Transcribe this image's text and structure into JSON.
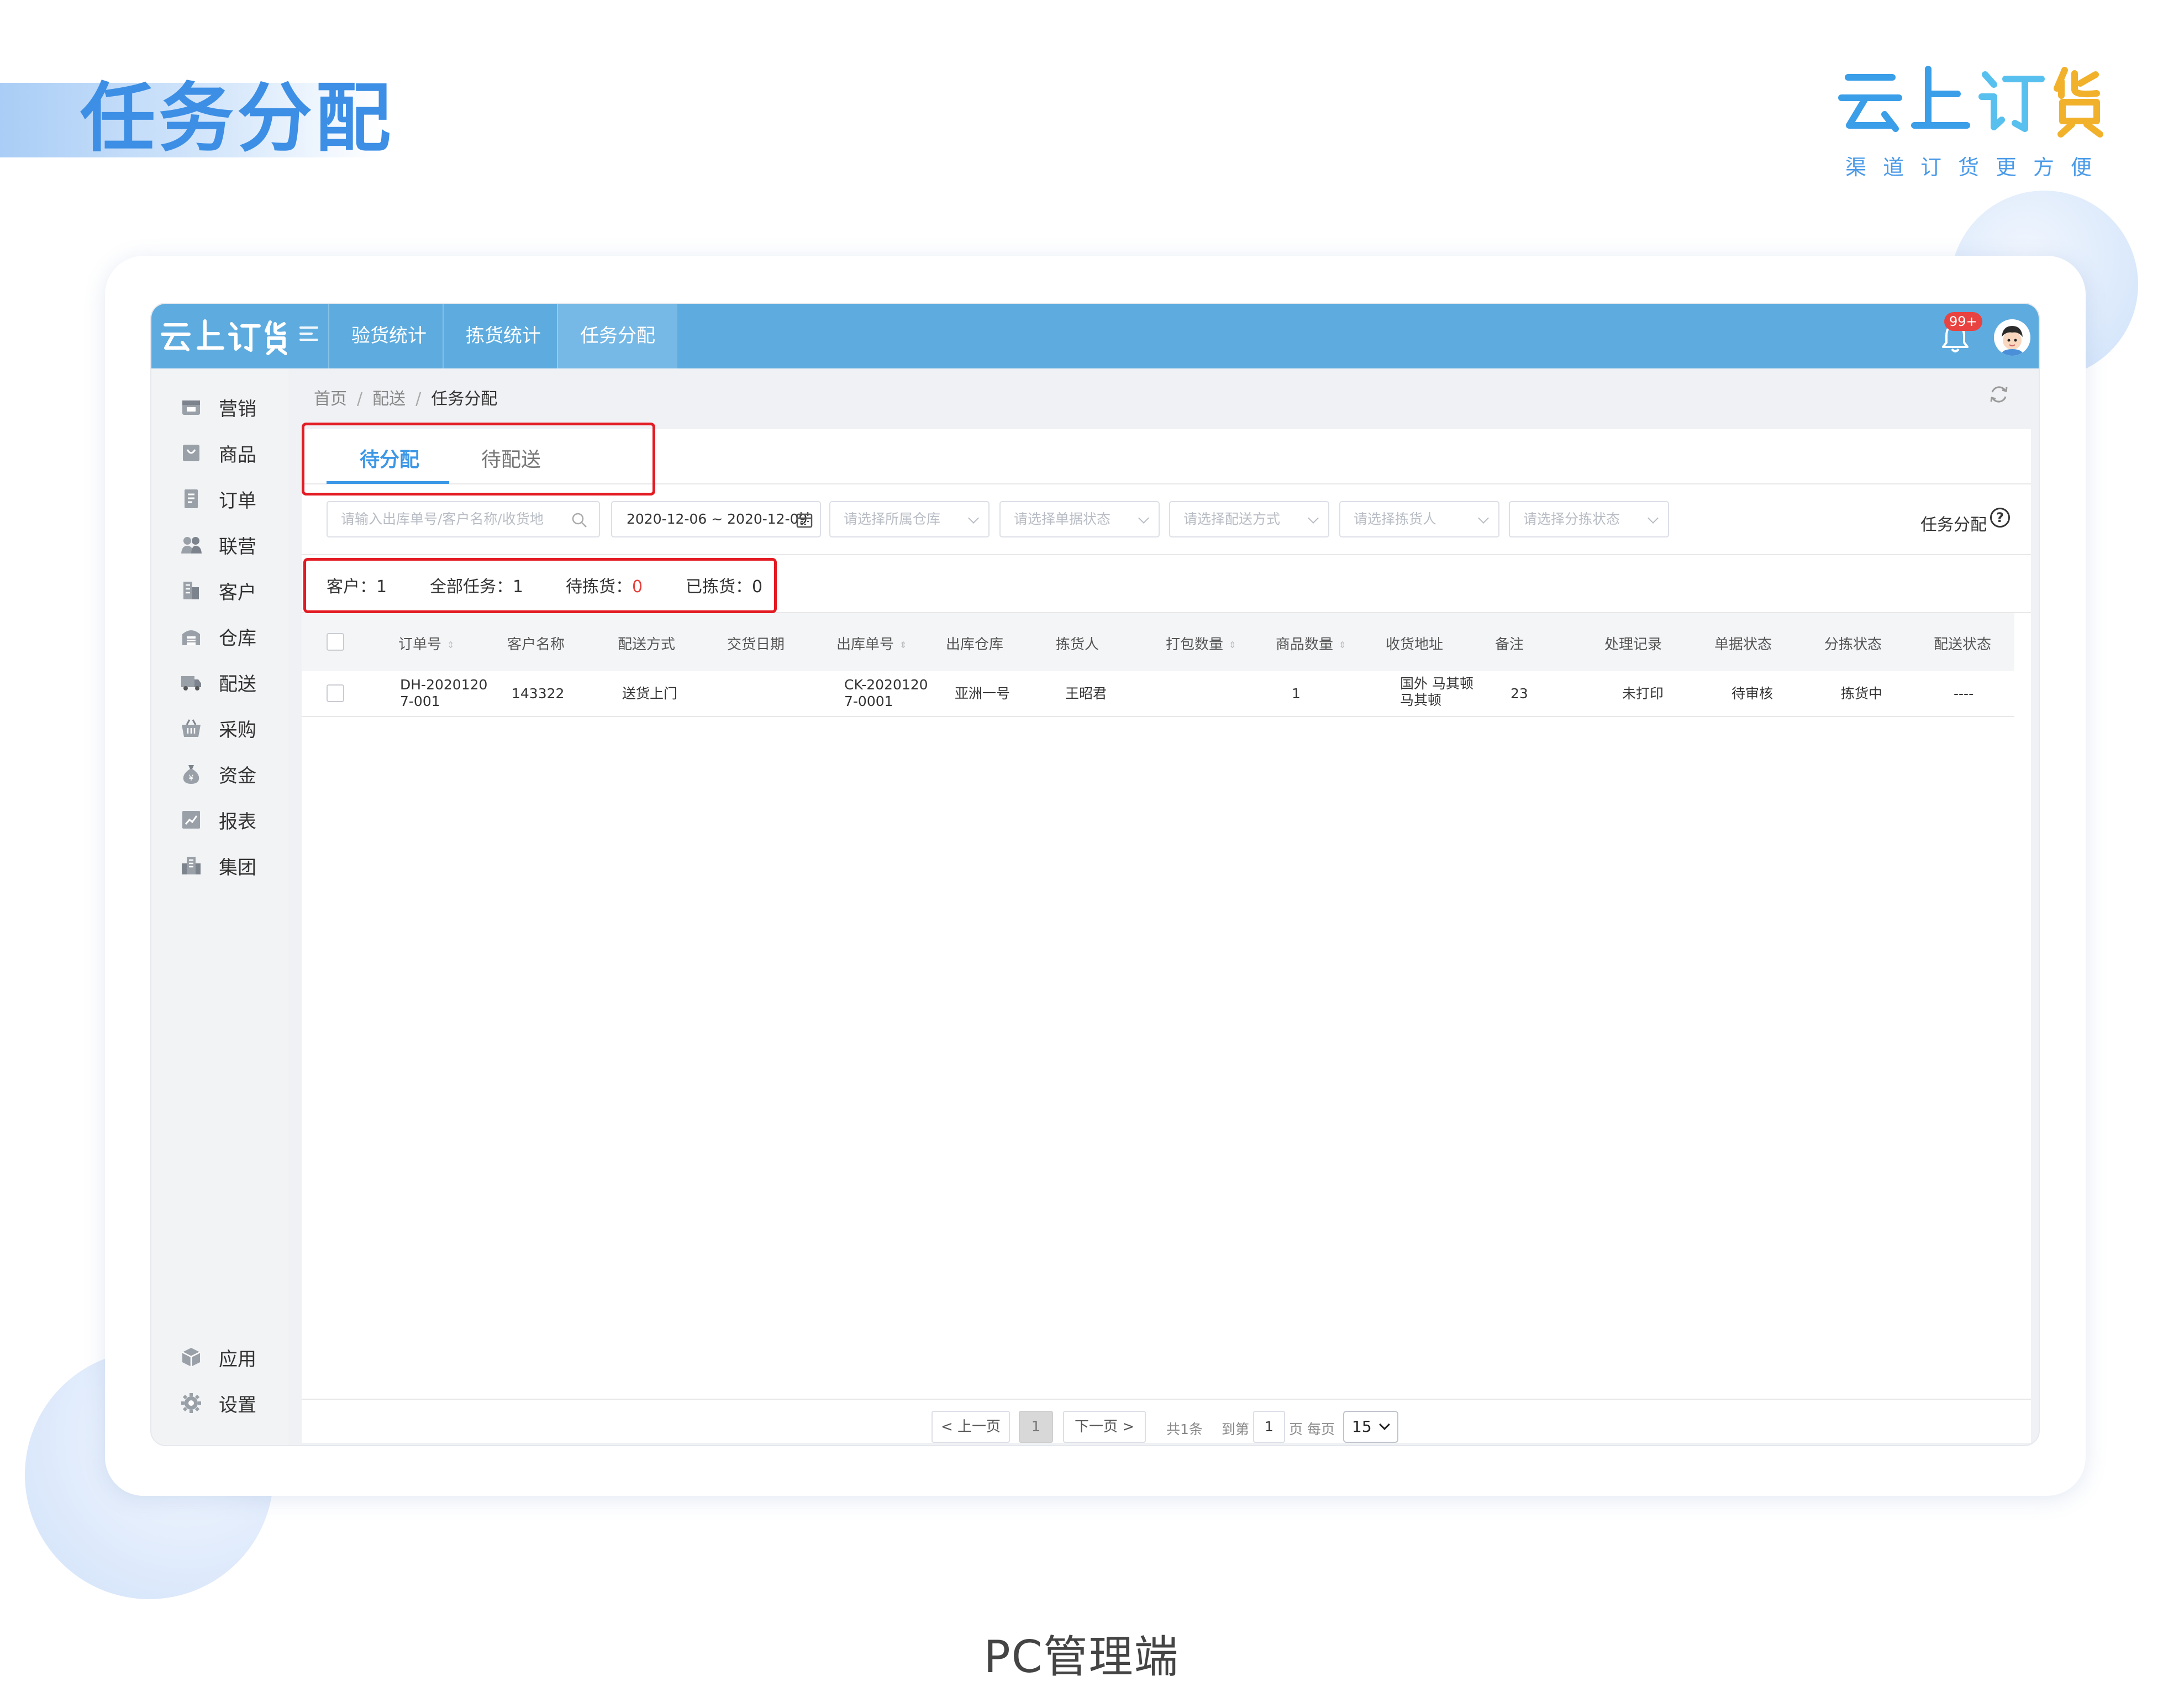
{
  "page": {
    "title": "任务分配",
    "brand_name": "云上订货",
    "brand_slogan": "渠道订货更方便",
    "caption": "PC管理端"
  },
  "colors": {
    "topbar": "#5eacdf",
    "accent": "#3c97e6",
    "highlight_box": "#e31b23",
    "danger": "#e8413c"
  },
  "topbar": {
    "logo_text": "云上订货",
    "tabs": [
      {
        "label": "验货统计",
        "active": false
      },
      {
        "label": "拣货统计",
        "active": false
      },
      {
        "label": "任务分配",
        "active": true
      }
    ],
    "notification_badge": "99+",
    "icons": [
      "menu-toggle-icon",
      "bell-icon",
      "avatar"
    ]
  },
  "sidebar": {
    "items": [
      {
        "label": "营销",
        "icon": "marketing-icon"
      },
      {
        "label": "商品",
        "icon": "product-icon"
      },
      {
        "label": "订单",
        "icon": "order-icon"
      },
      {
        "label": "联营",
        "icon": "partner-icon"
      },
      {
        "label": "客户",
        "icon": "customer-icon"
      },
      {
        "label": "仓库",
        "icon": "warehouse-icon"
      },
      {
        "label": "配送",
        "icon": "delivery-icon"
      },
      {
        "label": "采购",
        "icon": "purchase-icon"
      },
      {
        "label": "资金",
        "icon": "funds-icon"
      },
      {
        "label": "报表",
        "icon": "report-icon"
      },
      {
        "label": "集团",
        "icon": "group-icon"
      }
    ],
    "bottom_items": [
      {
        "label": "应用",
        "icon": "app-icon"
      },
      {
        "label": "设置",
        "icon": "settings-icon"
      }
    ]
  },
  "breadcrumb": [
    "首页",
    "配送",
    "任务分配"
  ],
  "tabs": [
    {
      "label": "待分配",
      "active": true
    },
    {
      "label": "待配送",
      "active": false
    }
  ],
  "filters": {
    "search_placeholder": "请输入出库单号/客户名称/收货地",
    "date_range": "2020-12-06 ~ 2020-12-09",
    "warehouse_placeholder": "请选择所属仓库",
    "doc_status_placeholder": "请选择单据状态",
    "delivery_method_placeholder": "请选择配送方式",
    "picker_placeholder": "请选择拣货人",
    "pick_status_placeholder": "请选择分拣状态",
    "task_assign_label": "任务分配",
    "help_glyph": "?"
  },
  "stats": {
    "customers_label": "客户：",
    "customers_value": "1",
    "all_tasks_label": "全部任务：",
    "all_tasks_value": "1",
    "pending_pick_label": "待拣货：",
    "pending_pick_value": "0",
    "picked_label": "已拣货：",
    "picked_value": "0"
  },
  "table": {
    "columns": [
      "订单号",
      "客户名称",
      "配送方式",
      "交货日期",
      "出库单号",
      "出库仓库",
      "拣货人",
      "打包数量",
      "商品数量",
      "收货地址",
      "备注",
      "处理记录",
      "单据状态",
      "分拣状态",
      "配送状态"
    ],
    "sortable_glyph": "⇕",
    "rows": [
      {
        "order_no_line1": "DH-2020120",
        "order_no_line2": "7-001",
        "customer": "143322",
        "delivery_method": "送货上门",
        "delivery_date": "",
        "outbound_no_line1": "CK-2020120",
        "outbound_no_line2": "7-0001",
        "warehouse": "亚洲一号",
        "picker": "王昭君",
        "pack_qty": "",
        "item_qty": "1",
        "address_line1": "国外 马其顿",
        "address_line2": "马其顿",
        "remark": "23",
        "process_record": "未打印",
        "doc_status": "待审核",
        "pick_status": "拣货中",
        "delivery_status": "----"
      }
    ]
  },
  "pagination": {
    "prev_label": "< 上一页",
    "current_page": "1",
    "next_label": "下一页 >",
    "total_text": "共1条",
    "goto_label": "到第",
    "goto_value": "1",
    "per_page_label": "页 每页",
    "page_size": "15"
  }
}
